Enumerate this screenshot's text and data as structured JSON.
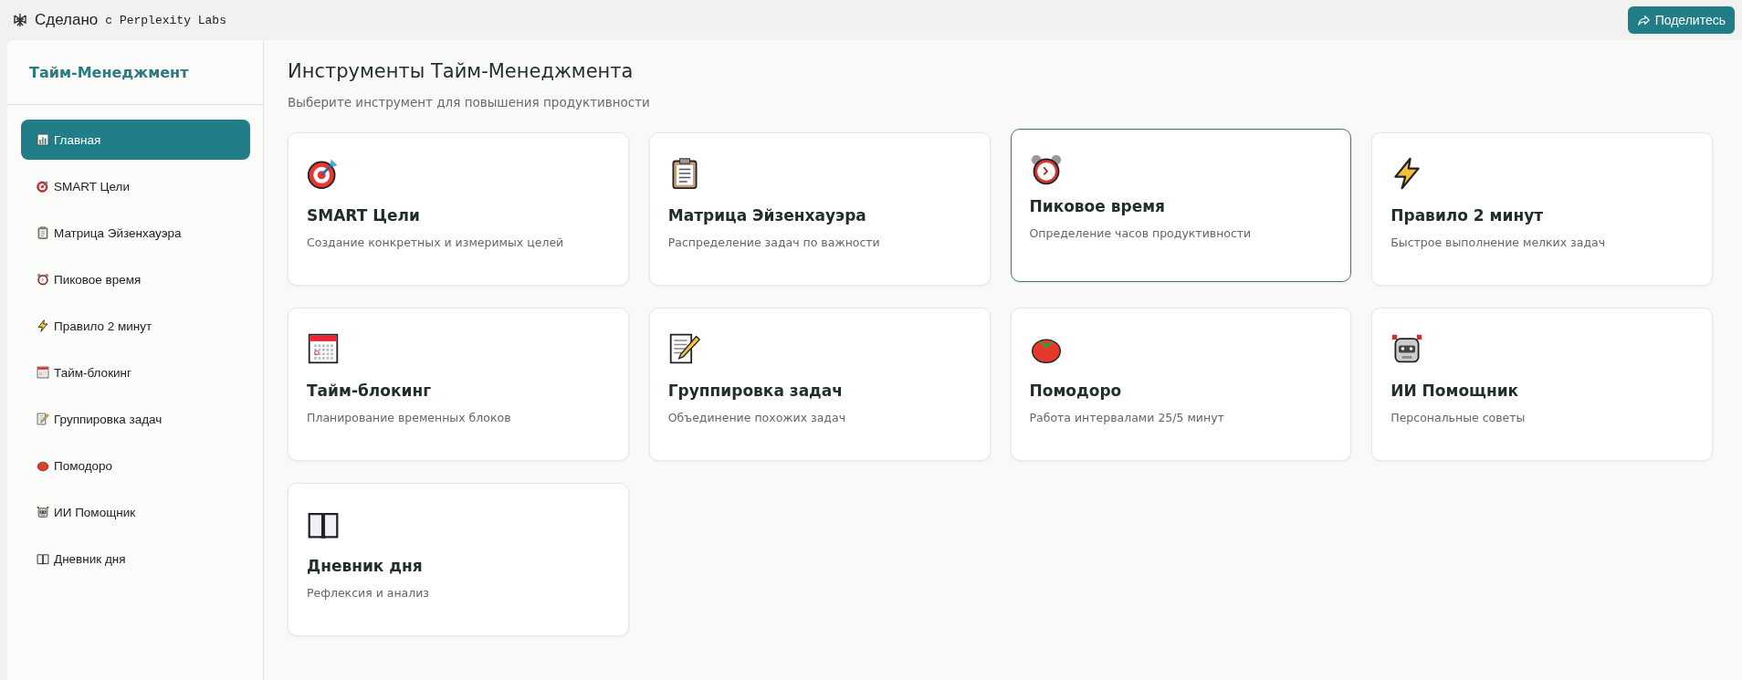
{
  "top_bar": {
    "brand": "Сделано",
    "brand_suffix": "с Perplexity Labs",
    "share_button": "Поделитесь"
  },
  "sidebar": {
    "title": "Тайм-Менеджмент",
    "items": [
      {
        "kind": "chart",
        "label": "Главная",
        "selected": true
      },
      {
        "kind": "target",
        "label": "SMART Цели",
        "selected": false
      },
      {
        "kind": "clipboard",
        "label": "Матрица Эйзенхауэра",
        "selected": false
      },
      {
        "kind": "alarm",
        "label": "Пиковое время",
        "selected": false
      },
      {
        "kind": "lightning",
        "label": "Правило 2 минут",
        "selected": false
      },
      {
        "kind": "calendar",
        "label": "Тайм-блокинг",
        "selected": false
      },
      {
        "kind": "memo",
        "label": "Группировка задач",
        "selected": false
      },
      {
        "kind": "tomato",
        "label": "Помодоро",
        "selected": false
      },
      {
        "kind": "robot",
        "label": "ИИ Помощник",
        "selected": false
      },
      {
        "kind": "book",
        "label": "Дневник дня",
        "selected": false
      }
    ]
  },
  "main": {
    "title": "Инструменты Тайм-Менеджмента",
    "subtitle": "Выберите инструмент для повышения продуктивности",
    "cards": [
      {
        "kind": "target",
        "title": "SMART Цели",
        "description": "Создание конкретных и измеримых целей",
        "hovered": false
      },
      {
        "kind": "clipboard",
        "title": "Матрица Эйзенхауэра",
        "description": "Распределение задач по важности",
        "hovered": false
      },
      {
        "kind": "alarm",
        "title": "Пиковое время",
        "description": "Определение часов продуктивности",
        "hovered": true
      },
      {
        "kind": "lightning",
        "title": "Правило 2 минут",
        "description": "Быстрое выполнение мелких задач",
        "hovered": false
      },
      {
        "kind": "calendar",
        "title": "Тайм-блокинг",
        "description": "Планирование временных блоков",
        "hovered": false
      },
      {
        "kind": "memo",
        "title": "Группировка задач",
        "description": "Объединение похожих задач",
        "hovered": false
      },
      {
        "kind": "tomato",
        "title": "Помодоро",
        "description": "Работа интервалами 25/5 минут",
        "hovered": false
      },
      {
        "kind": "robot",
        "title": "ИИ Помощник",
        "description": "Персональные советы",
        "hovered": false
      },
      {
        "kind": "book",
        "title": "Дневник дня",
        "description": "Рефлексия и анализ",
        "hovered": false
      }
    ]
  }
}
